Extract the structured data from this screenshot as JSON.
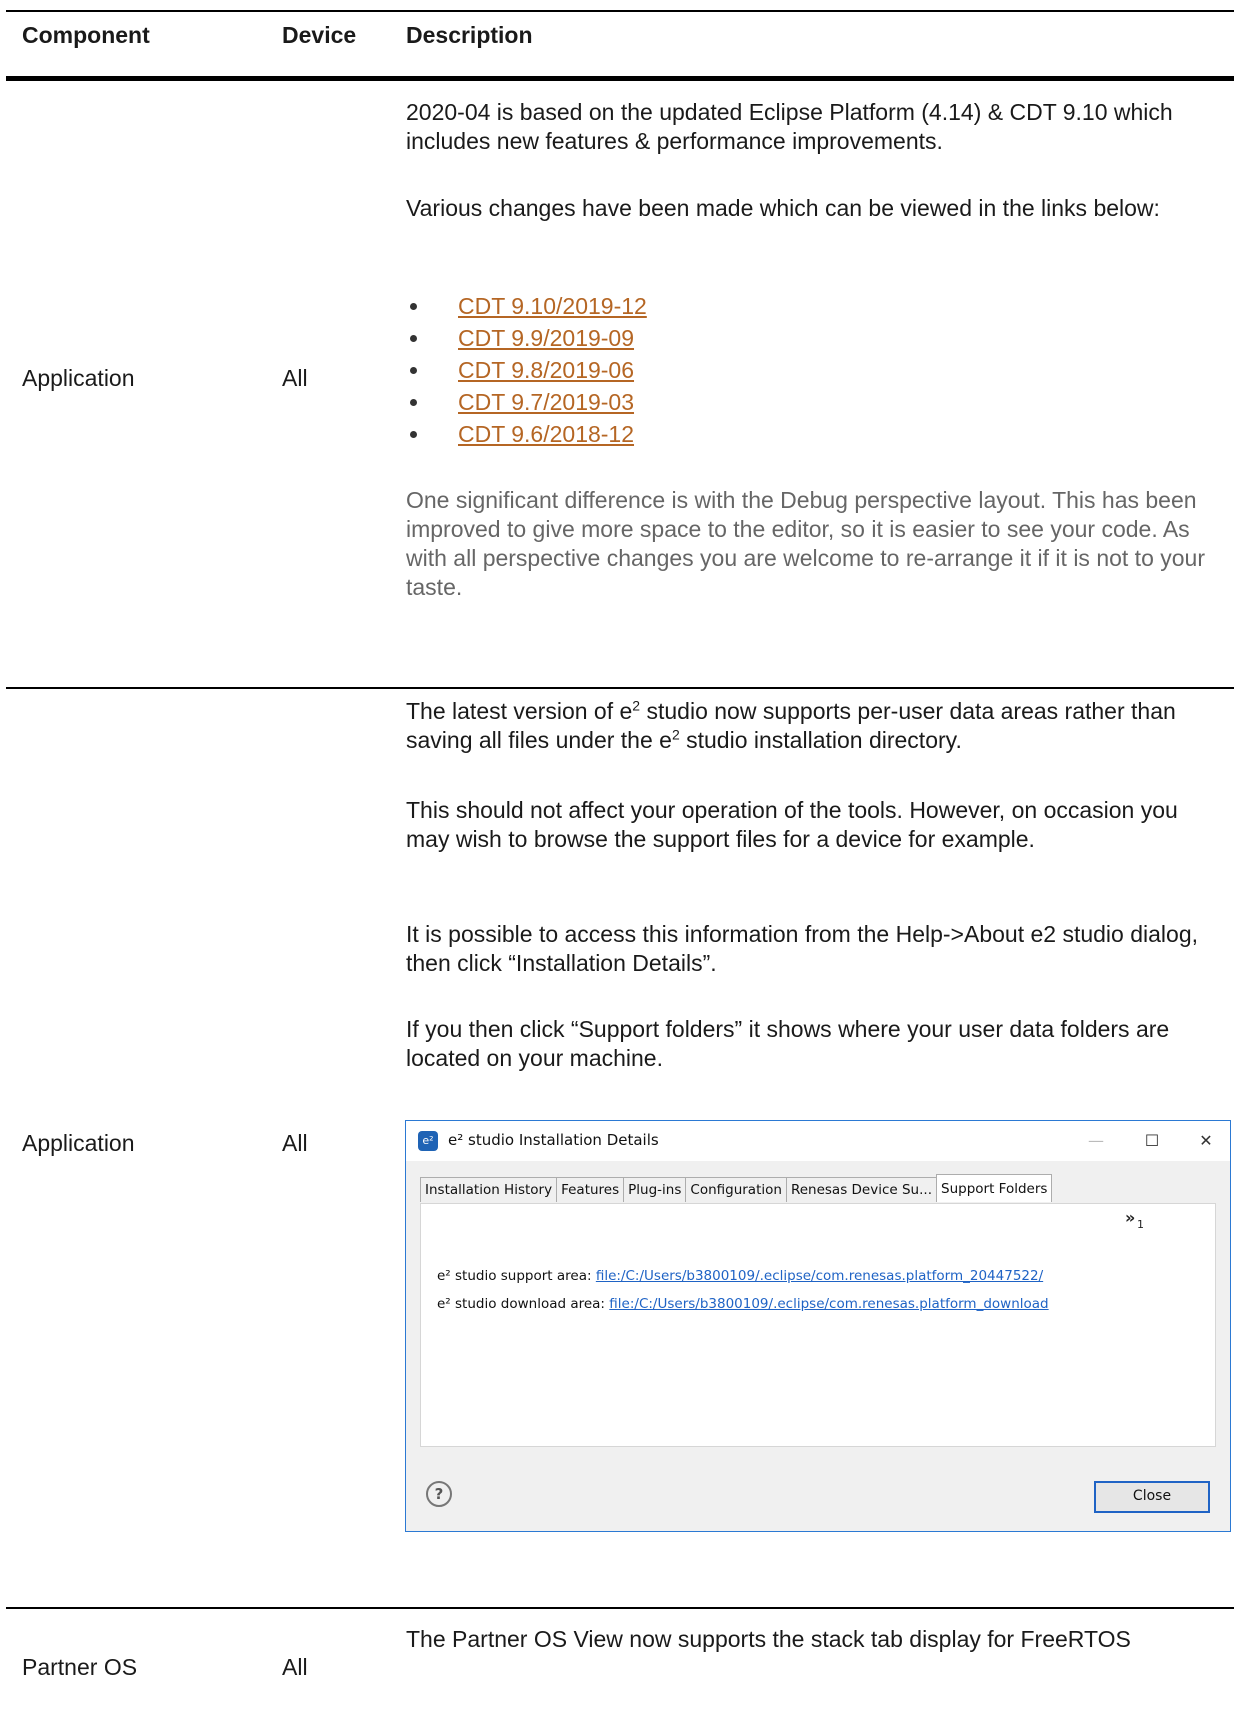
{
  "table": {
    "headers": {
      "component": "Component",
      "device": "Device",
      "description": "Description"
    },
    "rows": [
      {
        "component": "Application",
        "device": "All",
        "paragraphs": [
          "2020-04 is based on the updated Eclipse Platform (4.14) & CDT 9.10 which includes new features & performance improvements.",
          "Various changes have been made which can be viewed in the links below:"
        ],
        "links": [
          "CDT 9.10/2019-12",
          "CDT 9.9/2019-09",
          "CDT 9.8/2019-06",
          "CDT 9.7/2019-03",
          "CDT 9.6/2018-12"
        ],
        "note": "One significant difference is with the Debug perspective layout. This has been improved to give more space to the editor, so it is easier to see your code. As with all perspective changes you are welcome to re-arrange it if it is not to your taste."
      },
      {
        "component": "Application",
        "device": "All",
        "p1_a": "The latest version of e",
        "p1_sup1": "2",
        "p1_b": " studio now supports per-user data areas rather than saving all files under the e",
        "p1_sup2": "2",
        "p1_c": " studio installation directory.",
        "paragraphs": [
          "This should not affect your operation of the tools. However, on occasion you may wish to browse the support files for a device for example.",
          "It is possible to access this information from the Help->About e2 studio dialog, then click “Installation Details”.",
          "If you then click “Support folders” it shows where your user data folders are located on your machine."
        ],
        "dialog": {
          "logo": "e²",
          "title": "e² studio Installation Details",
          "tabs": [
            "Installation History",
            "Features",
            "Plug-ins",
            "Configuration",
            "Renesas Device Su...",
            "Support Folders"
          ],
          "active_tab": "Support Folders",
          "overflow_chevron": "»",
          "overflow_count": "1",
          "support_label": "e² studio support area:",
          "support_link": "file:/C:/Users/b3800109/.eclipse/com.renesas.platform_20447522/",
          "download_label": "e² studio download area:",
          "download_link": "file:/C:/Users/b3800109/.eclipse/com.renesas.platform_download",
          "help_icon": "?",
          "close_button": "Close"
        }
      },
      {
        "component": "Partner OS",
        "device": "All",
        "description": "The Partner OS View now supports the stack tab display for FreeRTOS"
      }
    ]
  }
}
